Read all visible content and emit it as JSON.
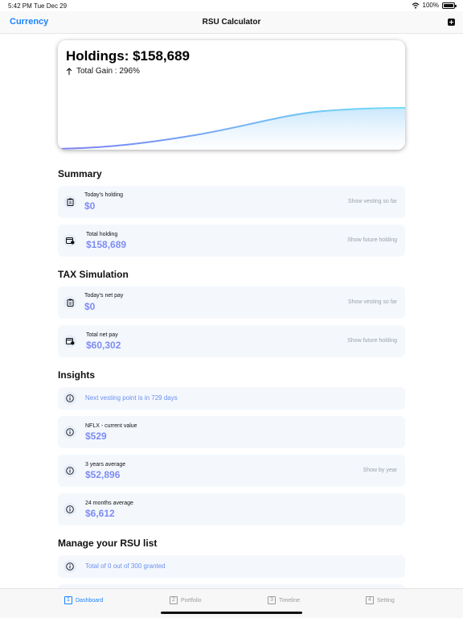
{
  "status": {
    "time": "5:42 PM",
    "date": "Tue Dec 29",
    "battery": "100%"
  },
  "nav": {
    "left": "Currency",
    "title": "RSU Calculator"
  },
  "hero": {
    "holdings": "Holdings: $158,689",
    "gain": "Total Gain : 296%"
  },
  "summary": {
    "title": "Summary",
    "cards": [
      {
        "label": "Today's holding",
        "value": "$0",
        "action": "Show vesting so far",
        "icon": "clipboard-icon"
      },
      {
        "label": "Total holding",
        "value": "$158,689",
        "action": "Show future holding",
        "icon": "calendar-clock-icon"
      }
    ]
  },
  "tax": {
    "title": "TAX Simulation",
    "cards": [
      {
        "label": "Today's net pay",
        "value": "$0",
        "action": "Show vesting so far",
        "icon": "clipboard-icon"
      },
      {
        "label": "Total net pay",
        "value": "$60,302",
        "action": "Show future holding",
        "icon": "calendar-clock-icon"
      }
    ]
  },
  "insights": {
    "title": "Insights",
    "next_vesting": "Next vesting point is in 729 days",
    "cards": [
      {
        "label": "NFLX - current value",
        "value": "$529",
        "action": ""
      },
      {
        "label": "3 years average",
        "value": "$52,896",
        "action": "Show by year"
      },
      {
        "label": "24 months average",
        "value": "$6,612",
        "action": ""
      }
    ]
  },
  "manage": {
    "title": "Manage your RSU list",
    "granted": "Total of 0 out of 300 granted"
  },
  "tabs": [
    {
      "num": "1",
      "label": "Dashboard"
    },
    {
      "num": "2",
      "label": "Portfolio"
    },
    {
      "num": "3",
      "label": "Timeline"
    },
    {
      "num": "4",
      "label": "Setting"
    }
  ],
  "colors": {
    "accent": "#1a84ff",
    "value": "#7f8cf3",
    "card_bg": "#f4f8fd"
  }
}
